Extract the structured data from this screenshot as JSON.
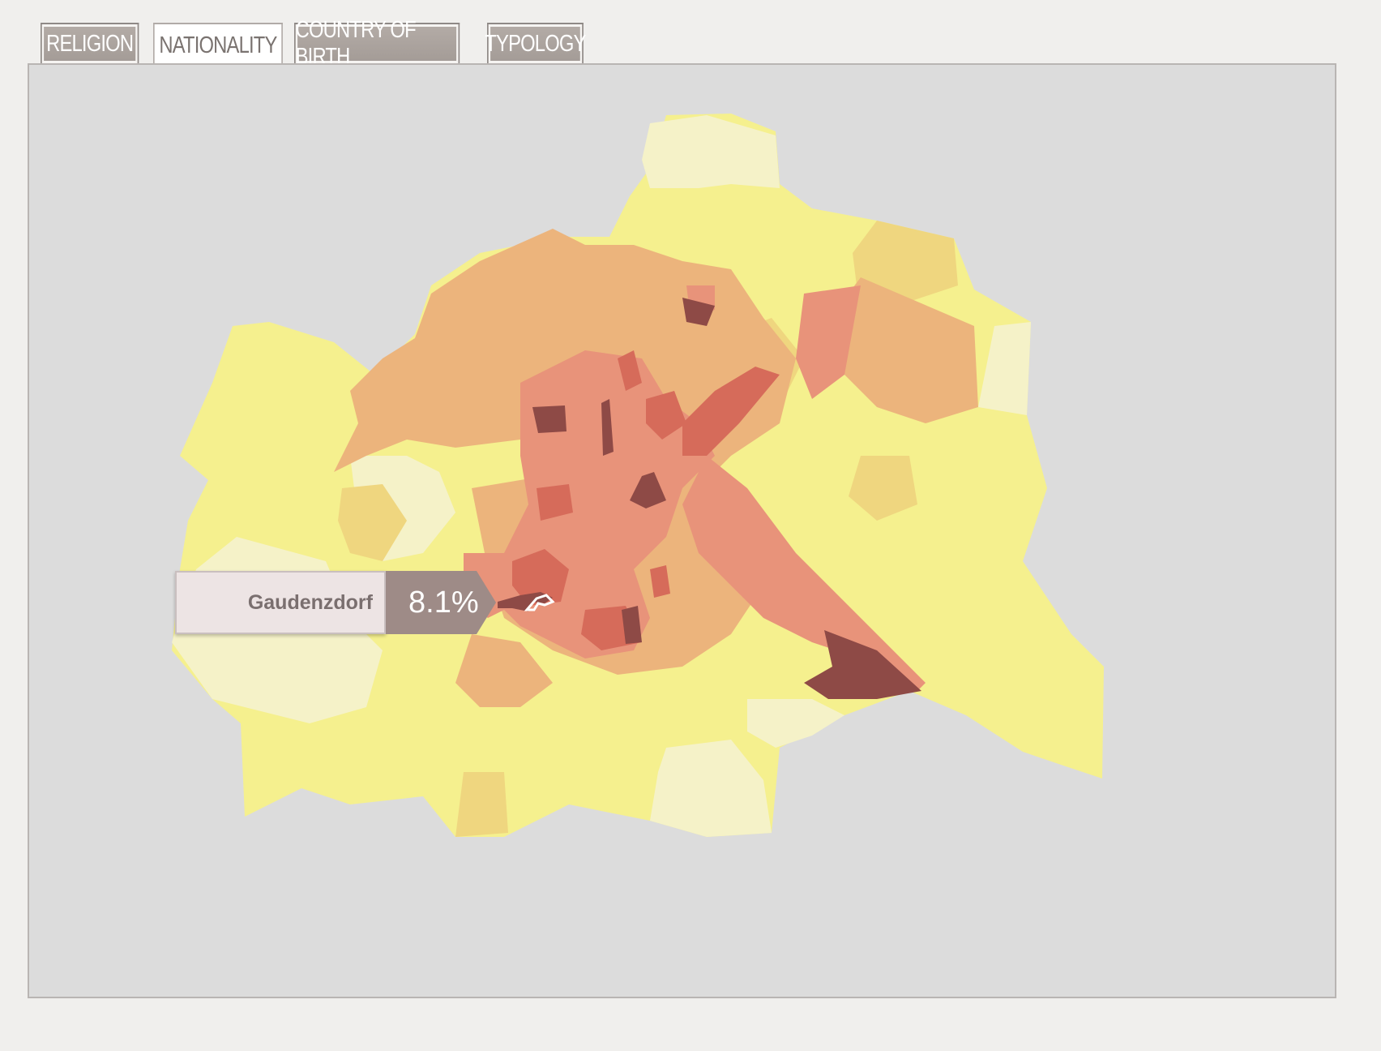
{
  "tabs": [
    {
      "label": "RELIGION",
      "active": false
    },
    {
      "label": "NATIONALITY",
      "active": true
    },
    {
      "label": "COUNTRY OF BIRTH",
      "active": false
    },
    {
      "label": "TYPOLOGY",
      "active": false
    }
  ],
  "tooltip": {
    "district": "Gaudenzdorf",
    "value": "8.1%"
  },
  "map_colors": {
    "background": "#dcdcdc",
    "very_low": "#f5f2c8",
    "low": "#f5f08e",
    "medium_low": "#efd67f",
    "medium": "#ecb47c",
    "medium_high": "#e8937a",
    "high": "#d66b5a",
    "very_high": "#8e4a46"
  }
}
